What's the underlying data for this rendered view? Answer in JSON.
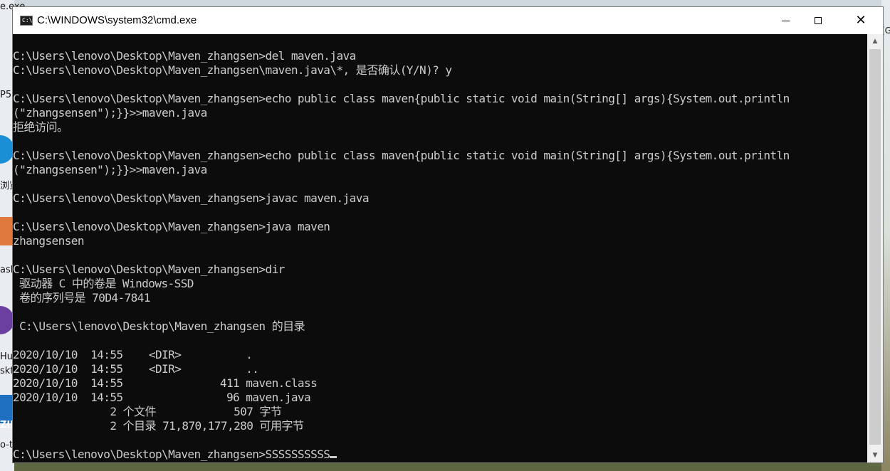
{
  "desktop": {
    "left_labels": [
      "e.exe",
      "P5",
      "浏览",
      "ashi",
      "Hu",
      "skto",
      "ZIP",
      "o-t"
    ],
    "right_labels": [
      "(G"
    ]
  },
  "window": {
    "title": "C:\\WINDOWS\\system32\\cmd.exe",
    "icon": "cmd-icon",
    "icon_glyph": "C:\\",
    "controls": {
      "minimize": "minimize-icon",
      "maximize": "maximize-icon",
      "close": "close-icon",
      "close_glyph": "✕"
    }
  },
  "console": {
    "lines": [
      "C:\\Users\\lenovo\\Desktop\\Maven_zhangsen>del maven.java",
      "C:\\Users\\lenovo\\Desktop\\Maven_zhangsen\\maven.java\\*, 是否确认(Y/N)? y",
      "",
      "C:\\Users\\lenovo\\Desktop\\Maven_zhangsen>echo public class maven{public static void main(String[] args){System.out.println",
      "(\"zhangsensen\");}}>>maven.java",
      "拒绝访问。",
      "",
      "C:\\Users\\lenovo\\Desktop\\Maven_zhangsen>echo public class maven{public static void main(String[] args){System.out.println",
      "(\"zhangsensen\");}}>>maven.java",
      "",
      "C:\\Users\\lenovo\\Desktop\\Maven_zhangsen>javac maven.java",
      "",
      "C:\\Users\\lenovo\\Desktop\\Maven_zhangsen>java maven",
      "zhangsensen",
      "",
      "C:\\Users\\lenovo\\Desktop\\Maven_zhangsen>dir",
      " 驱动器 C 中的卷是 Windows-SSD",
      " 卷的序列号是 70D4-7841",
      "",
      " C:\\Users\\lenovo\\Desktop\\Maven_zhangsen 的目录",
      "",
      "2020/10/10  14:55    <DIR>          .",
      "2020/10/10  14:55    <DIR>          ..",
      "2020/10/10  14:55               411 maven.class",
      "2020/10/10  14:55                96 maven.java",
      "               2 个文件            507 字节",
      "               2 个目录 71,870,177,280 可用字节",
      ""
    ],
    "prompt_line": "C:\\Users\\lenovo\\Desktop\\Maven_zhangsen>SSSSSSSSSS",
    "colors": {
      "background": "#0c0c0c",
      "foreground": "#cccccc"
    }
  },
  "scrollbar": {
    "up_glyph": "▲",
    "down_glyph": "▼"
  }
}
